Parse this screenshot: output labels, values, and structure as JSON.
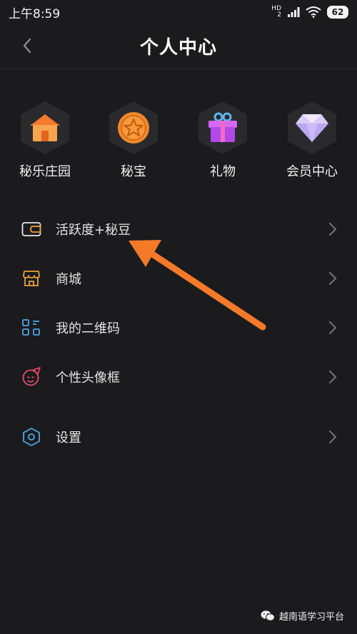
{
  "status_bar": {
    "time": "上午8:59",
    "hd_top": "HD",
    "hd_bottom": "2",
    "battery": "62",
    "icons": [
      "signal-icon",
      "wifi-icon",
      "battery-icon"
    ]
  },
  "header": {
    "title": "个人中心",
    "back_icon": "chevron-left-icon"
  },
  "grid": [
    {
      "label": "秘乐庄园",
      "icon": "house-icon",
      "color": "#f5a14a"
    },
    {
      "label": "秘宝",
      "icon": "star-coin-icon",
      "color": "#f08a2a"
    },
    {
      "label": "礼物",
      "icon": "gift-icon",
      "color": "#b348e8"
    },
    {
      "label": "会员中心",
      "icon": "diamond-icon",
      "color": "#c8b8f5"
    }
  ],
  "menu": [
    {
      "label": "活跃度+秘豆",
      "icon": "wallet-icon"
    },
    {
      "label": "商城",
      "icon": "store-icon"
    },
    {
      "label": "我的二维码",
      "icon": "qrcode-icon"
    },
    {
      "label": "个性头像框",
      "icon": "avatar-frame-icon"
    },
    {
      "label": "设置",
      "icon": "settings-hex-icon"
    }
  ],
  "annotation": {
    "color": "#f47a2a"
  },
  "watermark": {
    "text": "越南语学习平台",
    "icon": "wechat-icon"
  }
}
